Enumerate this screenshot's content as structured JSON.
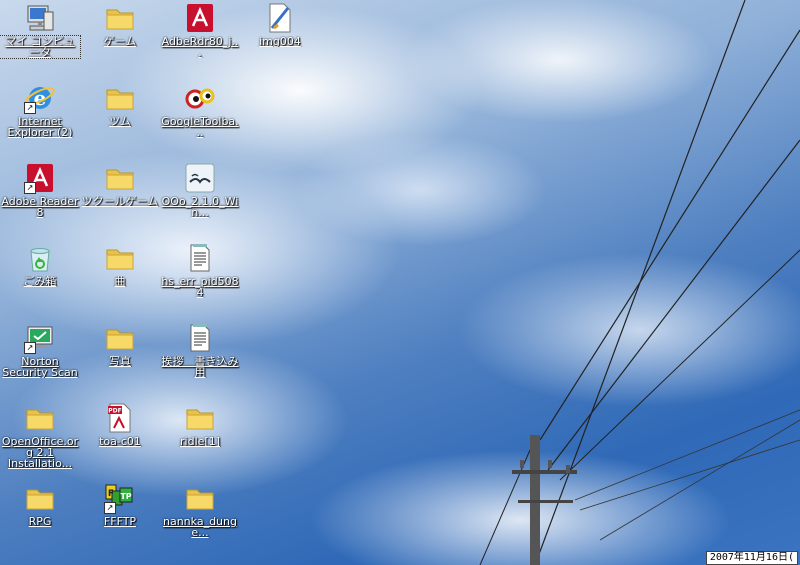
{
  "desktop": {
    "icons": [
      {
        "label": "マイ コンピュータ",
        "icon": "my-computer-icon",
        "shortcut": false
      },
      {
        "label": "ゲーム",
        "icon": "folder-icon",
        "shortcut": false
      },
      {
        "label": "AdbeRdr80_j...",
        "icon": "adobe-reader-icon",
        "shortcut": false
      },
      {
        "label": "img004",
        "icon": "image-file-icon",
        "shortcut": false
      },
      {
        "label": "Internet Explorer (2)",
        "icon": "internet-explorer-icon",
        "shortcut": true
      },
      {
        "label": "ツム",
        "icon": "folder-icon",
        "shortcut": false
      },
      {
        "label": "GoogleToolba...",
        "icon": "google-toolbar-icon",
        "shortcut": false
      },
      {
        "label": "Adobe Reader 8",
        "icon": "adobe-reader-icon",
        "shortcut": true
      },
      {
        "label": "ツクールゲーム",
        "icon": "folder-icon",
        "shortcut": false
      },
      {
        "label": "OOo_2.1.0_Win...",
        "icon": "openoffice-installer-icon",
        "shortcut": false
      },
      {
        "label": "ごみ箱",
        "icon": "recycle-bin-icon",
        "shortcut": false
      },
      {
        "label": "曲",
        "icon": "folder-icon",
        "shortcut": false
      },
      {
        "label": "hs_err_pid5084",
        "icon": "text-file-icon",
        "shortcut": false
      },
      {
        "label": "Norton Security Scan",
        "icon": "norton-icon",
        "shortcut": true
      },
      {
        "label": "写真",
        "icon": "folder-icon",
        "shortcut": false
      },
      {
        "label": "挨拶　書き込み用",
        "icon": "text-file-icon",
        "shortcut": false
      },
      {
        "label": "OpenOffice.org 2.1 Installatio...",
        "icon": "folder-icon",
        "shortcut": false
      },
      {
        "label": "toa-c01",
        "icon": "pdf-file-icon",
        "shortcut": false
      },
      {
        "label": "ridle[1]",
        "icon": "folder-icon",
        "shortcut": false
      },
      {
        "label": "RPG",
        "icon": "folder-icon",
        "shortcut": false
      },
      {
        "label": "FFFTP",
        "icon": "ffftp-icon",
        "shortcut": true
      },
      {
        "label": "nannka_dunge...",
        "icon": "folder-icon",
        "shortcut": false
      }
    ]
  },
  "clock": {
    "text": "2007年11月16日("
  },
  "colors": {
    "folder": "#f5d35a",
    "adobe": "#c8102e",
    "sky": "#3b74c0"
  }
}
